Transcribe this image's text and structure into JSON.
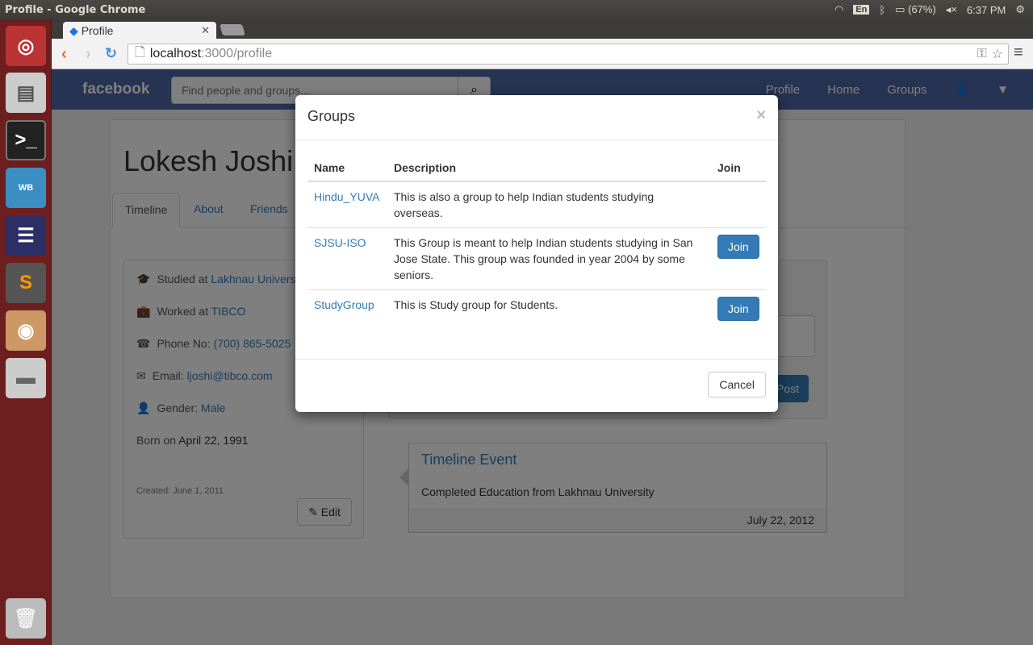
{
  "os": {
    "window_title": "Profile - Google Chrome",
    "keyboard": "En",
    "battery": "(67%)",
    "time": "6:37 PM"
  },
  "browser": {
    "tab_title": "Profile",
    "url_host": "localhost",
    "url_path": ":3000/profile"
  },
  "navbar": {
    "brand": "facebook",
    "search_placeholder": "Find people and groups...",
    "links": [
      "Profile",
      "Home",
      "Groups"
    ]
  },
  "profile": {
    "name": "Lokesh Joshi",
    "tabs": [
      "Timeline",
      "About",
      "Friends"
    ],
    "studied_label": "Studied at ",
    "studied": "Lakhnau University",
    "worked_label": "Worked at ",
    "worked": "TIBCO",
    "phone_label": "Phone No: ",
    "phone": "(700) 865-5025",
    "email_label": "Email: ",
    "email": "ljoshi@tibco.com",
    "gender_label": "Gender: ",
    "gender": "Male",
    "born_label": "Born on ",
    "born": "April 22, 1991",
    "created": "Created: June 1, 2011",
    "edit": "Edit",
    "post": "Post"
  },
  "event": {
    "title": "Timeline Event",
    "description": "Completed Education from Lakhnau University",
    "date": "July 22, 2012"
  },
  "modal": {
    "title": "Groups",
    "close": "×",
    "headers": [
      "Name",
      "Description",
      "Join"
    ],
    "rows": [
      {
        "name": "Hindu_YUVA",
        "description": "This is also a group to help Indian students studying overseas.",
        "join": ""
      },
      {
        "name": "SJSU-ISO",
        "description": "This Group is meant to help Indian students studying in San Jose State. This group was founded in year 2004 by some seniors.",
        "join": "Join"
      },
      {
        "name": "StudyGroup",
        "description": "This is Study group for Students.",
        "join": "Join"
      }
    ],
    "cancel": "Cancel"
  }
}
